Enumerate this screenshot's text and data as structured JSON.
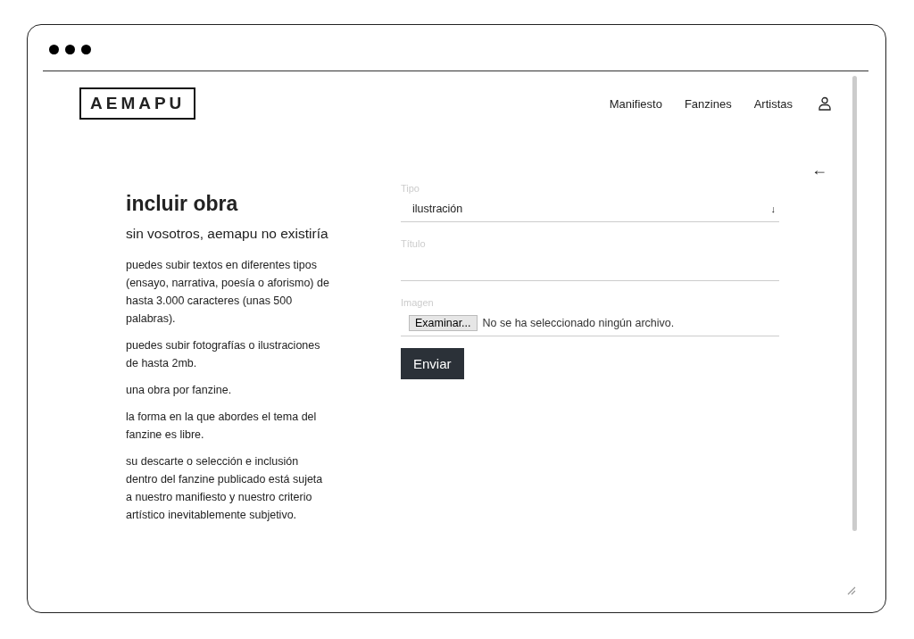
{
  "header": {
    "logo": "AEMAPU",
    "nav": [
      {
        "label": "Manifiesto"
      },
      {
        "label": "Fanzines"
      },
      {
        "label": "Artistas"
      }
    ]
  },
  "intro": {
    "title": "incluir obra",
    "subtitle": "sin vosotros, aemapu no existiría",
    "paragraphs": [
      "puedes subir textos en diferentes tipos (ensayo, narrativa, poesía o aforismo) de hasta 3.000 caracteres (unas 500 palabras).",
      "puedes subir fotografías o ilustraciones de hasta 2mb.",
      "una obra por fanzine.",
      "la forma en la que abordes el tema del fanzine es libre.",
      "su descarte o selección e inclusión dentro del fanzine publicado está sujeta a nuestro manifiesto y nuestro criterio artístico inevitablemente subjetivo."
    ]
  },
  "form": {
    "fields": [
      {
        "kind": "select",
        "label": "Tipo",
        "value": "ilustración",
        "arrow": "↓"
      },
      {
        "kind": "text",
        "label": "Título"
      },
      {
        "kind": "file",
        "label": "Imagen",
        "button": "Examinar...",
        "status": "No se ha seleccionado ningún archivo."
      }
    ],
    "submit": "Enviar",
    "back": "←"
  }
}
